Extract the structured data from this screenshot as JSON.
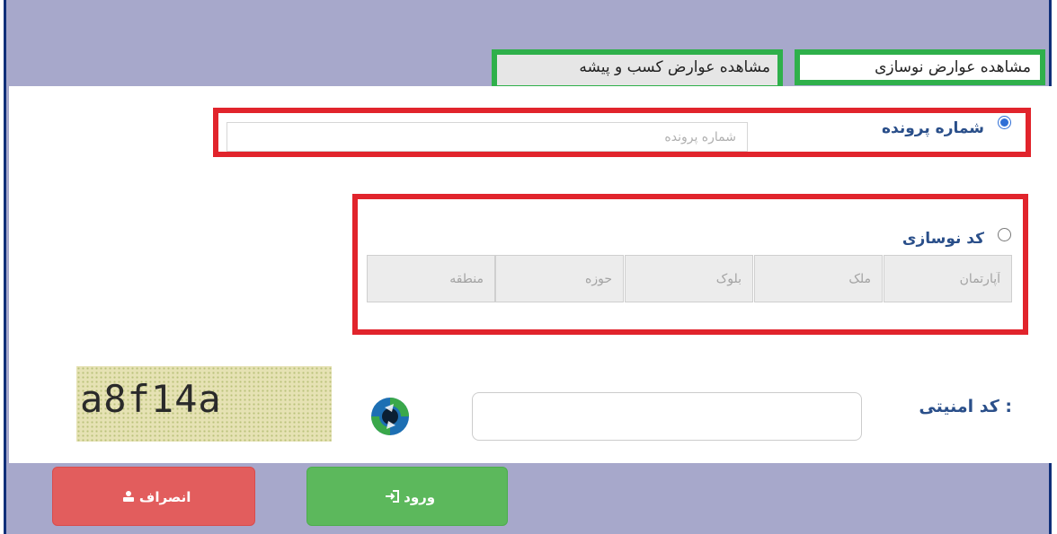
{
  "tabs": [
    {
      "label": "مشاهده عوارض نوسازی",
      "active": true
    },
    {
      "label": "مشاهده عوارض کسب و پیشه",
      "active": false
    }
  ],
  "file_number": {
    "label": "شماره پرونده",
    "placeholder": "شماره پرونده",
    "selected": true
  },
  "renewal_code": {
    "label": "کد نوسازی",
    "selected": false,
    "fields": [
      {
        "placeholder": "آپارتمان"
      },
      {
        "placeholder": "ملک"
      },
      {
        "placeholder": "بلوک"
      },
      {
        "placeholder": "حوزه"
      },
      {
        "placeholder": "منطقه"
      }
    ]
  },
  "security": {
    "label": "کد امنیتی :",
    "captcha_text": "a8f14a",
    "value": ""
  },
  "buttons": {
    "login": "ورود",
    "cancel": "انصراف"
  },
  "colors": {
    "background": "#a7a8cb",
    "highlight_green": "#2fb04b",
    "highlight_red": "#e1242c",
    "login": "#5cb85c",
    "cancel": "#e25d5d",
    "label_blue": "#2a4f8a"
  }
}
